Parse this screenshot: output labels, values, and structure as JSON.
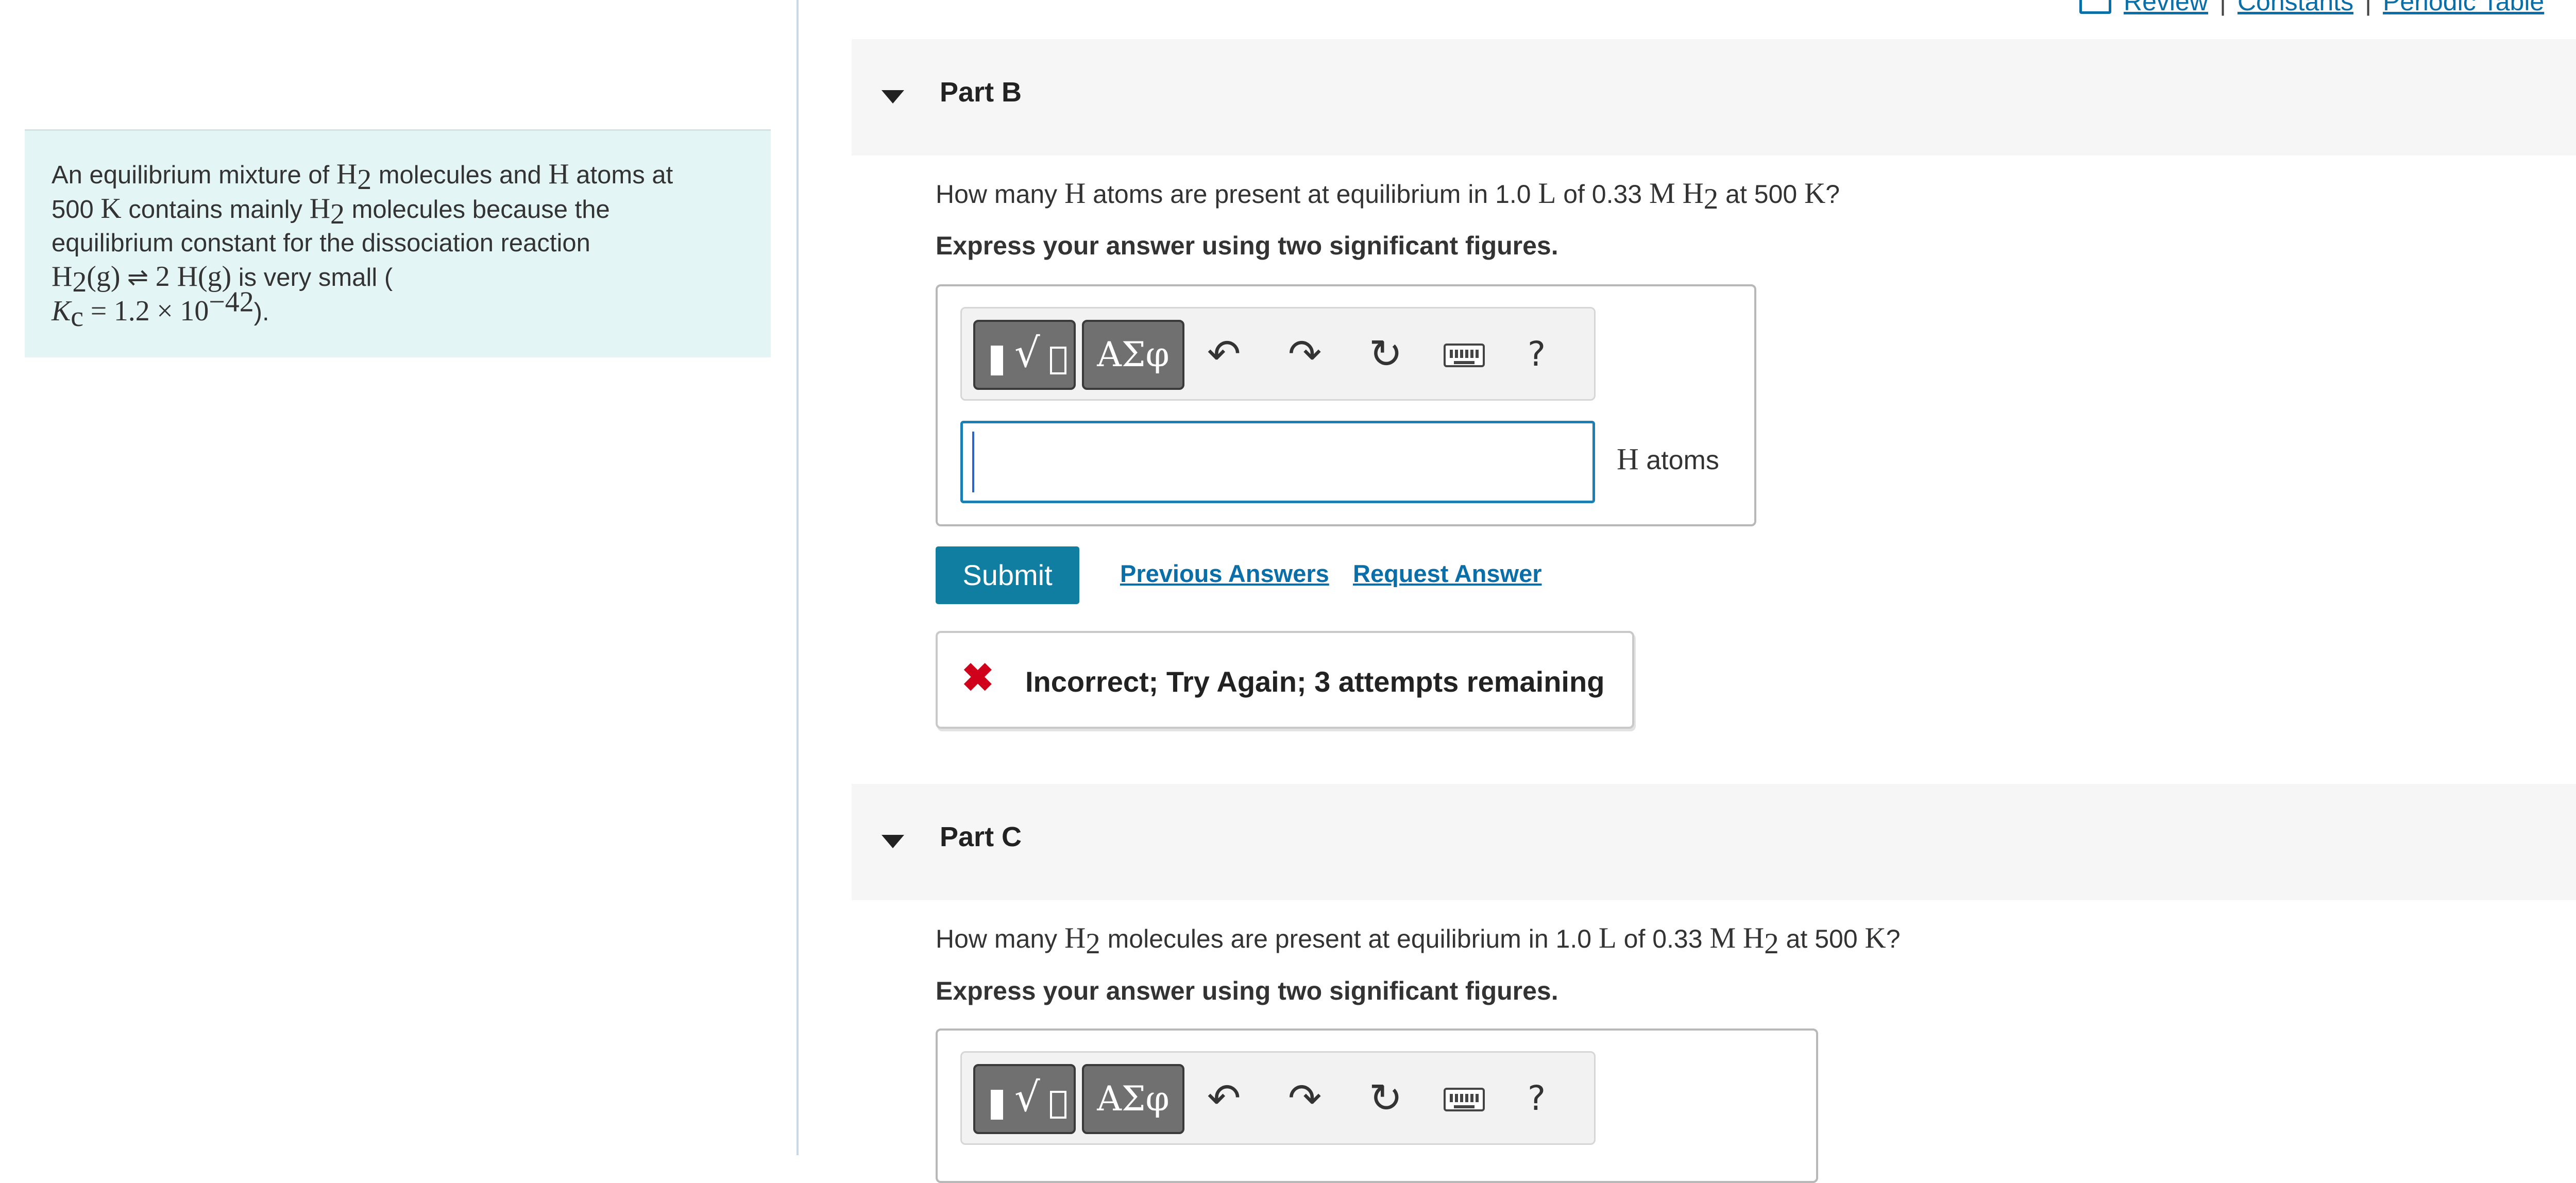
{
  "top_links": {
    "review": "Review",
    "constants": "Constants",
    "periodic_table": "Periodic Table",
    "separator": "|"
  },
  "intro": {
    "t1": "An equilibrium mixture of ",
    "H": "H",
    "sub2": "2",
    "t2": " molecules and ",
    "t3": " atoms at",
    "n500": "500",
    "K": "K",
    "t4": " contains mainly ",
    "t5": " molecules because the",
    "t6": "equilibrium constant for the dissociation reaction",
    "eq_g1": "(g)",
    "eq_arrow": "⇌",
    "eq_rhs": "2 H(g)",
    "t7": " is very small (",
    "Kc": "K",
    "c_sub": "c",
    "equals": "=",
    "kval": "1.2",
    "times": "×",
    "ten": "10",
    "exp": "−42",
    "close": ")."
  },
  "part_b": {
    "title": "Part B",
    "q1": "How many ",
    "qH": "H",
    "q2": " atoms are present at equilibrium in 1.0 ",
    "qL": "L",
    "q3": " of 0.33 ",
    "qM": "M",
    "qH2": "H",
    "q_sub": "2",
    "q4": " at 500 ",
    "qK": "K",
    "q5": "?",
    "instruction": "Express your answer using two significant figures.",
    "unit_symbol": "H",
    "unit_text": " atoms",
    "submit": "Submit",
    "prev_answers": "Previous Answers",
    "request_answer": "Request Answer",
    "feedback": "Incorrect; Try Again; 3 attempts remaining"
  },
  "part_c": {
    "title": "Part C",
    "q1": "How many ",
    "qH2a": "H",
    "q_sub_a": "2",
    "q2": " molecules are present at equilibrium in 1.0 ",
    "qL": "L",
    "q3": " of 0.33 ",
    "qM": "M",
    "qH2b": "H",
    "q_sub_b": "2",
    "q4": " at 500 ",
    "qK": "K",
    "q5": "?",
    "instruction": "Express your answer using two significant figures."
  },
  "toolbar": {
    "symbols_label": "ΑΣφ",
    "undo_glyph": "↶",
    "redo_glyph": "↷",
    "reset_glyph": "↻",
    "help_glyph": "?"
  },
  "icons": [
    "book-icon",
    "caret-down-icon",
    "templates-icon",
    "undo-icon",
    "redo-icon",
    "reset-icon",
    "keyboard-icon",
    "help-icon",
    "error-x-icon"
  ],
  "colors": {
    "accent": "#0f7ea1",
    "link": "#0a6ea8",
    "error": "#d0021b",
    "intro_bg": "#e4f5f5",
    "header_bg": "#f6f6f6"
  }
}
